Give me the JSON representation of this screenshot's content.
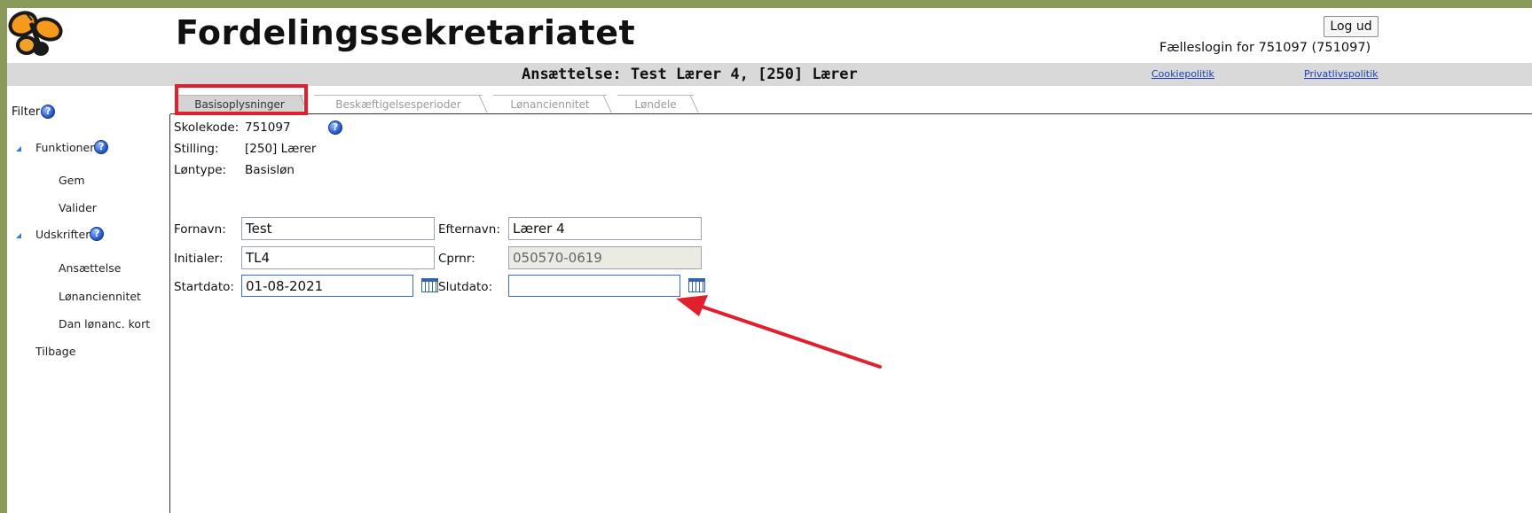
{
  "header": {
    "app_title": "Fordelingssekretariatet",
    "logout_label": "Log ud",
    "login_info": "Fælleslogin for 751097 (751097)"
  },
  "subheader": {
    "employment_title": "Ansættelse: Test Lærer 4, [250] Lærer",
    "cookie_link": "Cookiepolitik",
    "privacy_link": "Privatlivspolitik"
  },
  "sidebar": {
    "filter_label": "Filter",
    "sections": [
      {
        "label": "Funktioner",
        "items": [
          "Gem",
          "Valider"
        ]
      },
      {
        "label": "Udskrifter",
        "items": [
          "Ansættelse",
          "Lønanciennitet",
          "Dan lønanc. kort"
        ]
      }
    ],
    "back_label": "Tilbage"
  },
  "tabs": [
    {
      "label": "Basisoplysninger",
      "active": true
    },
    {
      "label": "Beskæftigelsesperioder",
      "active": false
    },
    {
      "label": "Lønanciennitet",
      "active": false
    },
    {
      "label": "Løndele",
      "active": false
    }
  ],
  "info": {
    "school_code_label": "Skolekode:",
    "school_code_value": "751097",
    "position_label": "Stilling:",
    "position_value": "[250] Lærer",
    "pay_type_label": "Løntype:",
    "pay_type_value": "Basisløn"
  },
  "form": {
    "first_name_label": "Fornavn:",
    "first_name_value": "Test",
    "last_name_label": "Efternavn:",
    "last_name_value": "Lærer 4",
    "initials_label": "Initialer:",
    "initials_value": "TL4",
    "cpr_label": "Cprnr:",
    "cpr_value": "050570-0619",
    "start_date_label": "Startdato:",
    "start_date_value": "01-08-2021",
    "end_date_label": "Slutdato:",
    "end_date_value": ""
  },
  "colors": {
    "frame_background": "#8a9a5b",
    "annotation_red": "#e0202c",
    "link_blue": "#1a3fb8"
  },
  "icons": [
    "butterfly-logo",
    "help-icon",
    "calendar-icon",
    "expand-triangle-icon",
    "annotation-arrow"
  ]
}
